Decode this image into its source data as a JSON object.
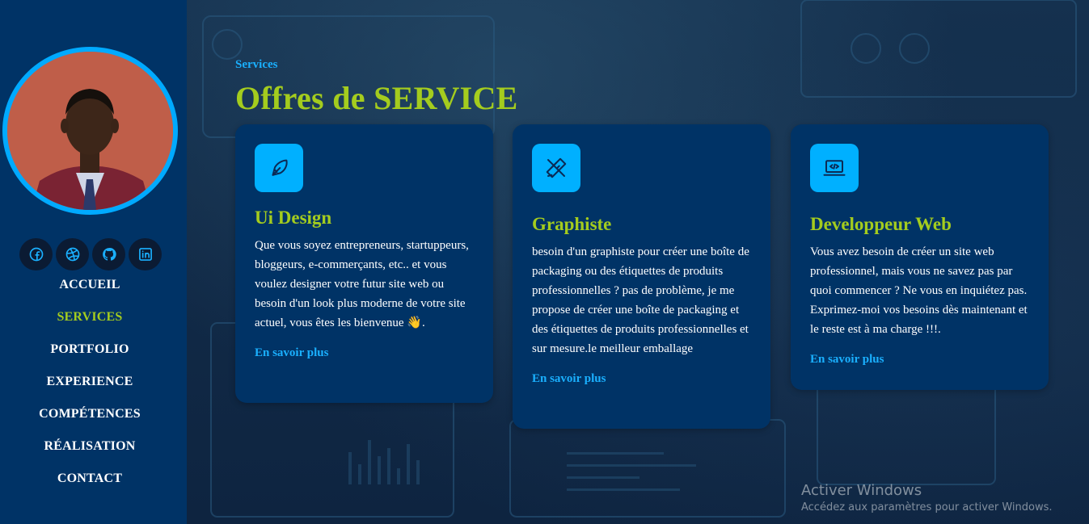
{
  "sidebar": {
    "socials": [
      {
        "icon": "facebook-icon"
      },
      {
        "icon": "dribbble-icon"
      },
      {
        "icon": "github-icon"
      },
      {
        "icon": "linkedin-icon"
      }
    ],
    "nav": [
      "ACCUEIL",
      "SERVICES",
      "PORTFOLIO",
      "EXPERIENCE",
      "COMPÉTENCES",
      "RÉALISATION",
      "CONTACT"
    ],
    "active_nav": "SERVICES"
  },
  "header": {
    "label": "Services",
    "title": "Offres de SERVICE"
  },
  "cards": [
    {
      "icon": "feather-pen-icon",
      "title": "Ui Design",
      "text": "Que vous soyez entrepreneurs, startuppeurs, bloggeurs, e-commerçants, etc.. et vous voulez designer votre futur site web ou besoin d'un look plus moderne de votre site actuel, vous êtes les bienvenue 👋.",
      "link": "En savoir plus"
    },
    {
      "icon": "ruler-pencil-icon",
      "title": "Graphiste",
      "text": "besoin d'un graphiste pour créer une boîte de packaging ou des étiquettes de produits professionnelles ? pas de problème, je me propose de créer une boîte de packaging et des étiquettes de produits professionnelles et sur mesure.le meilleur emballage",
      "link": "En savoir plus"
    },
    {
      "icon": "laptop-code-icon",
      "title": "Developpeur Web",
      "text": "Vous avez besoin de créer un site web professionnel, mais vous ne savez pas par quoi commencer ? Ne vous en inquiétez pas. Exprimez-moi vos besoins dès maintenant et le reste est à ma charge !!!.",
      "link": "En savoir plus"
    }
  ],
  "watermark": {
    "line1": "Activer Windows",
    "line2": "Accédez aux paramètres pour activer Windows."
  },
  "colors": {
    "sidebar_bg": "#003366",
    "accent_green": "#a4cc1e",
    "accent_blue": "#1ab0ff",
    "card_bg": "#003366",
    "icon_bg": "#00b0ff"
  }
}
